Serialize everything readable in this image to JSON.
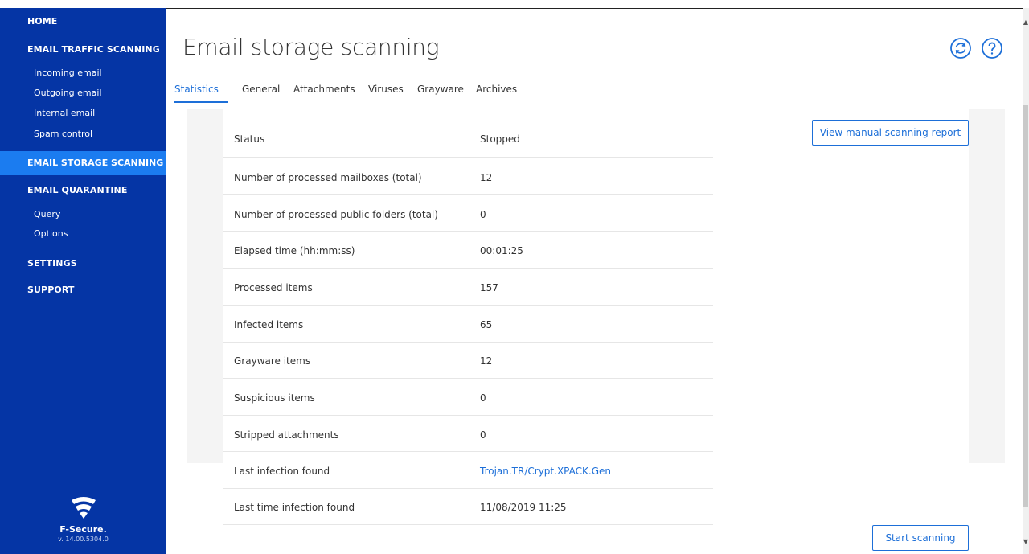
{
  "sidebar": {
    "home": "HOME",
    "email_traffic": "EMAIL TRAFFIC SCANNING",
    "traffic_items": [
      "Incoming email",
      "Outgoing email",
      "Internal email",
      "Spam control"
    ],
    "email_storage": "EMAIL STORAGE SCANNING",
    "email_quarantine": "EMAIL QUARANTINE",
    "quarantine_items": [
      "Query",
      "Options"
    ],
    "settings": "SETTINGS",
    "support": "SUPPORT",
    "logo_name": "F-Secure.",
    "version": "v. 14.00.5304.0"
  },
  "header": {
    "title": "Email storage scanning",
    "refresh_icon": "refresh-icon",
    "help_icon": "help-icon"
  },
  "tabs": [
    "Statistics",
    "General",
    "Attachments",
    "Viruses",
    "Grayware",
    "Archives"
  ],
  "active_tab": "Statistics",
  "stats": [
    {
      "label": "Status",
      "value": "Stopped"
    },
    {
      "label": "Number of processed mailboxes (total)",
      "value": "12"
    },
    {
      "label": "Number of processed public folders (total)",
      "value": "0"
    },
    {
      "label": "Elapsed time (hh:mm:ss)",
      "value": "00:01:25"
    },
    {
      "label": "Processed items",
      "value": "157"
    },
    {
      "label": "Infected items",
      "value": "65"
    },
    {
      "label": "Grayware items",
      "value": "12"
    },
    {
      "label": "Suspicious items",
      "value": "0"
    },
    {
      "label": "Stripped attachments",
      "value": "0"
    },
    {
      "label": "Last infection found",
      "value": "Trojan.TR/Crypt.XPACK.Gen"
    },
    {
      "label": "Last time infection found",
      "value": "11/08/2019 11:25"
    }
  ],
  "buttons": {
    "view_report": "View manual scanning report",
    "start_scanning": "Start scanning"
  },
  "colors": {
    "sidebar": "#0535a5",
    "sidebar_active": "#1b7cf0",
    "accent": "#1d6fd8"
  }
}
